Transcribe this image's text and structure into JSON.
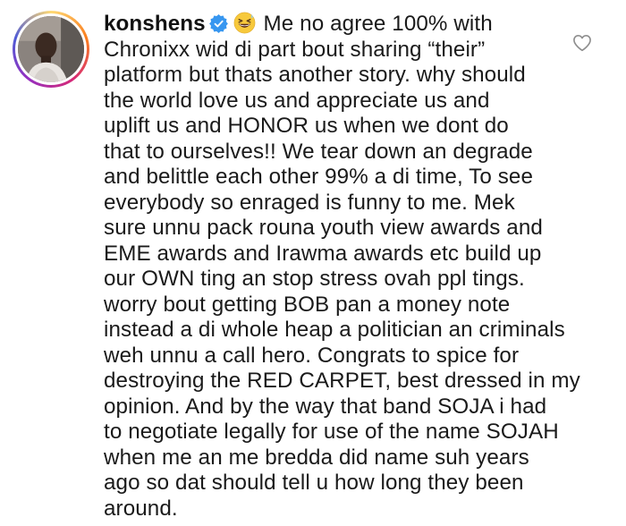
{
  "comment": {
    "username": "konshens",
    "verified": true,
    "emoji": "grinning-squinting-sweat-face",
    "lines": [
      "Me no agree 100% with",
      "Chronixx wid di part bout sharing “their”",
      "platform but thats another story.  why should",
      "the world love us and appreciate us and",
      "uplift us and HONOR us when we dont do",
      "that to ourselves!! We tear down an degrade",
      "and belittle each other 99% a di time, To see",
      "everybody so enraged is funny to me.  Mek",
      "sure unnu pack rouna youth view awards and",
      "EME awards and Irawma awards etc build up",
      "our OWN ting an stop stress ovah ppl tings.",
      "worry bout getting BOB pan a money note",
      "instead a di whole heap a politician an criminals",
      "weh unnu a call hero.  Congrats to spice for",
      "destroying the RED CARPET, best dressed in my",
      "opinion.  And by the way that band SOJA i had",
      "to negotiate legally for use of the name SOJAH",
      "when me an me bredda did name suh years",
      "ago so dat should tell u how long they been",
      "around."
    ]
  },
  "icons": {
    "avatar": "profile-photo",
    "verified": "verified-badge-icon",
    "like": "heart-outline-icon"
  },
  "colors": {
    "text": "#1a1a1a",
    "verified_blue": "#3897f0",
    "like_stroke": "#8e8e8e"
  }
}
